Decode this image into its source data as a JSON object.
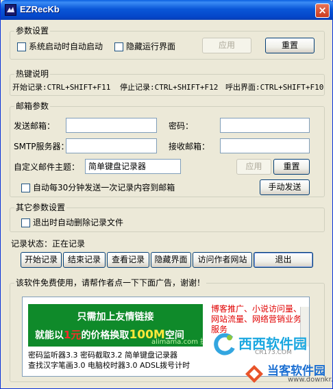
{
  "window": {
    "title": "EZRecKb",
    "close_glyph": "×"
  },
  "params": {
    "group_title": "参数设置",
    "autostart_label": "系统启动时自动启动",
    "autostart_checked": false,
    "hide_ui_label": "隐藏运行界面",
    "hide_ui_checked": false,
    "apply_label": "应用",
    "reset_label": "重置"
  },
  "hotkeys": {
    "group_title": "热键说明",
    "start": "开始记录:CTRL+SHIFT+F11",
    "stop": "停止记录:CTRL+SHIFT+F12",
    "show": "呼出界面:CTRL+SHIFT+F10"
  },
  "mail": {
    "group_title": "邮箱参数",
    "sender_label": "发送邮箱：",
    "sender_value": "",
    "password_label": "密码：",
    "password_value": "",
    "smtp_label": "SMTP服务器：",
    "smtp_value": "",
    "receiver_label": "接收邮箱：",
    "receiver_value": "",
    "subject_label": "自定义邮件主题：",
    "subject_value": "简单键盘记录器",
    "apply_label": "应用",
    "reset_label": "重置",
    "auto_send_label": "自动每30分钟发送一次记录内容到邮箱",
    "auto_send_checked": false,
    "manual_send_label": "手动发送"
  },
  "other": {
    "group_title": "其它参数设置",
    "delete_on_exit_label": "退出时自动删除记录文件",
    "delete_on_exit_checked": false
  },
  "status": {
    "label": "记录状态：正在记录"
  },
  "actions": {
    "start": "开始记录",
    "stop": "结束记录",
    "view": "查看记录",
    "hide": "隐藏界面",
    "visit": "访问作者网站",
    "exit": "退出"
  },
  "ad": {
    "group_title": "该软件免费使用，请帮作者点一下下面广告，谢谢！",
    "banner_line1": "只需加上友情链接",
    "banner_line2_a": "就能以",
    "banner_line2_b": "1元",
    "banner_line2_c": "的价格换取",
    "banner_line2_d": "100M",
    "banner_line2_e": "空间",
    "banner_sub": "alimama.com 提供",
    "red_text": "博客推广、小说访问量、网站流量、网络营销业务服务",
    "line1": "密码监听器3.3  密码截取3.2  简单键盘记录器",
    "line2": "查找汉字笔画3.0  电脑校时器3.0  ADSL拨号计时"
  },
  "watermarks": {
    "cr_name": "西西软件园",
    "cr_url": "CR173.COM",
    "dk_name": "当客软件园",
    "dk_url": "www.downkr.com"
  },
  "colors": {
    "title_bar": "#0a57d8",
    "window_bg": "#ece9d8",
    "banner_green": "#0f8a2a",
    "ad_red": "#e00000"
  }
}
